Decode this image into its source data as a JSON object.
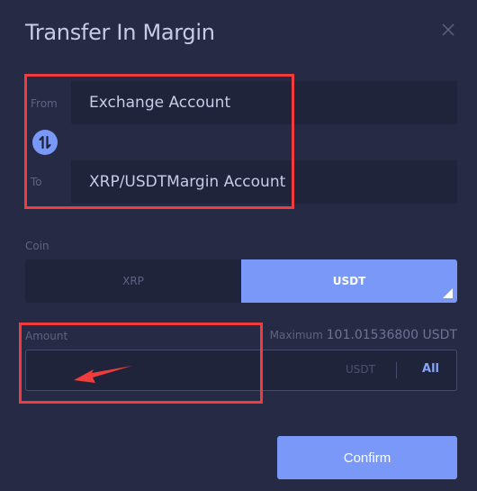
{
  "dialog": {
    "title": "Transfer In Margin",
    "close_icon": "close-icon"
  },
  "transfer": {
    "from_label": "From",
    "from_value": "Exchange Account",
    "to_label": "To",
    "to_value": "XRP/USDTMargin Account",
    "swap_icon": "swap-vertical-icon"
  },
  "coin": {
    "label": "Coin",
    "options": [
      {
        "label": "XRP",
        "selected": false
      },
      {
        "label": "USDT",
        "selected": true
      }
    ]
  },
  "amount": {
    "label": "Amount",
    "maximum_prefix": "Maximum",
    "maximum_value": "101.01536800 USDT",
    "value": "",
    "placeholder": "",
    "unit": "USDT",
    "all_label": "All"
  },
  "actions": {
    "confirm_label": "Confirm"
  },
  "colors": {
    "background": "#262a45",
    "accent": "#7a98f7",
    "annotation": "#f03c3c"
  }
}
